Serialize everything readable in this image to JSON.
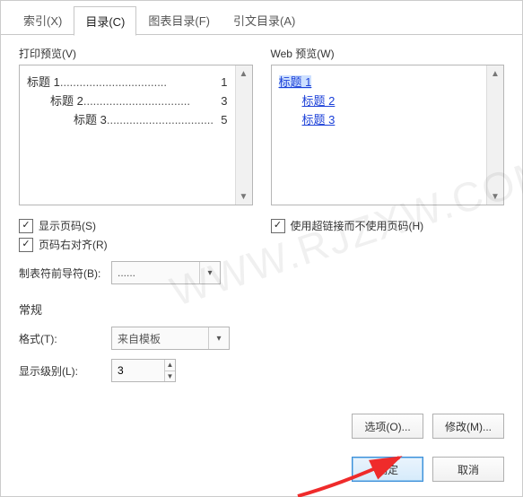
{
  "tabs": {
    "index": "索引(X)",
    "toc": "目录(C)",
    "figures": "图表目录(F)",
    "citations": "引文目录(A)"
  },
  "labels": {
    "print_preview": "打印预览(V)",
    "web_preview": "Web 预览(W)",
    "show_page_numbers": "显示页码(S)",
    "right_align": "页码右对齐(R)",
    "tab_leader": "制表符前导符(B):",
    "use_hyperlinks": "使用超链接而不使用页码(H)",
    "general": "常规",
    "format": "格式(T):",
    "show_levels": "显示级别(L):",
    "options": "选项(O)...",
    "modify": "修改(M)...",
    "ok": "确定",
    "cancel": "取消"
  },
  "print_preview_items": [
    {
      "text": "标题 1",
      "page": "1",
      "indent": ""
    },
    {
      "text": "标题 2",
      "page": "3",
      "indent": "indent1"
    },
    {
      "text": "标题 3",
      "page": "5",
      "indent": "indent2"
    }
  ],
  "web_preview_items": [
    {
      "text": "标题  1",
      "indent": "",
      "sel": true
    },
    {
      "text": "标题  2",
      "indent": "indent1",
      "sel": false
    },
    {
      "text": "标题  3",
      "indent": "indent1",
      "sel": false
    }
  ],
  "fields": {
    "tab_leader_value": "......",
    "format_value": "来自模板",
    "levels_value": "3"
  },
  "leader_dots": ".................................",
  "watermark": "WWW.RJZXW.COM"
}
